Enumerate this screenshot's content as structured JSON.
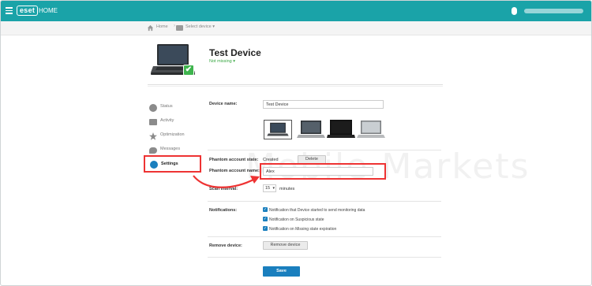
{
  "app": {
    "logo": "eset",
    "name": "HOME"
  },
  "breadcrumb": {
    "home": "Home",
    "device": "Select device ▾"
  },
  "device": {
    "title": "Test Device",
    "status": "Not missing ▾"
  },
  "sidebar": {
    "items": [
      {
        "label": "Status",
        "icon": "status-icon"
      },
      {
        "label": "Activity",
        "icon": "activity-icon"
      },
      {
        "label": "Optimization",
        "icon": "optimization-icon"
      },
      {
        "label": "Messages",
        "icon": "messages-icon"
      },
      {
        "label": "Settings",
        "icon": "gear-icon"
      }
    ]
  },
  "form": {
    "device_name_label": "Device name:",
    "device_name_value": "Test Device",
    "phantom_state_label": "Phantom account state:",
    "phantom_state_value": "Created",
    "delete_label": "Delete",
    "phantom_name_label": "Phantom account name:",
    "phantom_name_value": "Alex",
    "scan_interval_label": "Scan interval:",
    "scan_interval_value": "15",
    "scan_interval_unit": "minutes",
    "notifications_label": "Notifications:",
    "notifications": [
      "Notification that Device started to send monitoring data",
      "Notification on Suspicious state",
      "Notification on Missing state expiration"
    ],
    "remove_label": "Remove device:",
    "remove_button": "Remove device",
    "save_button": "Save"
  },
  "watermark": "Mobile Markets",
  "colors": {
    "brand": "#1aa3a8",
    "accent": "#1a7fbe",
    "highlight": "#ee3333",
    "success": "#3fb44e"
  }
}
